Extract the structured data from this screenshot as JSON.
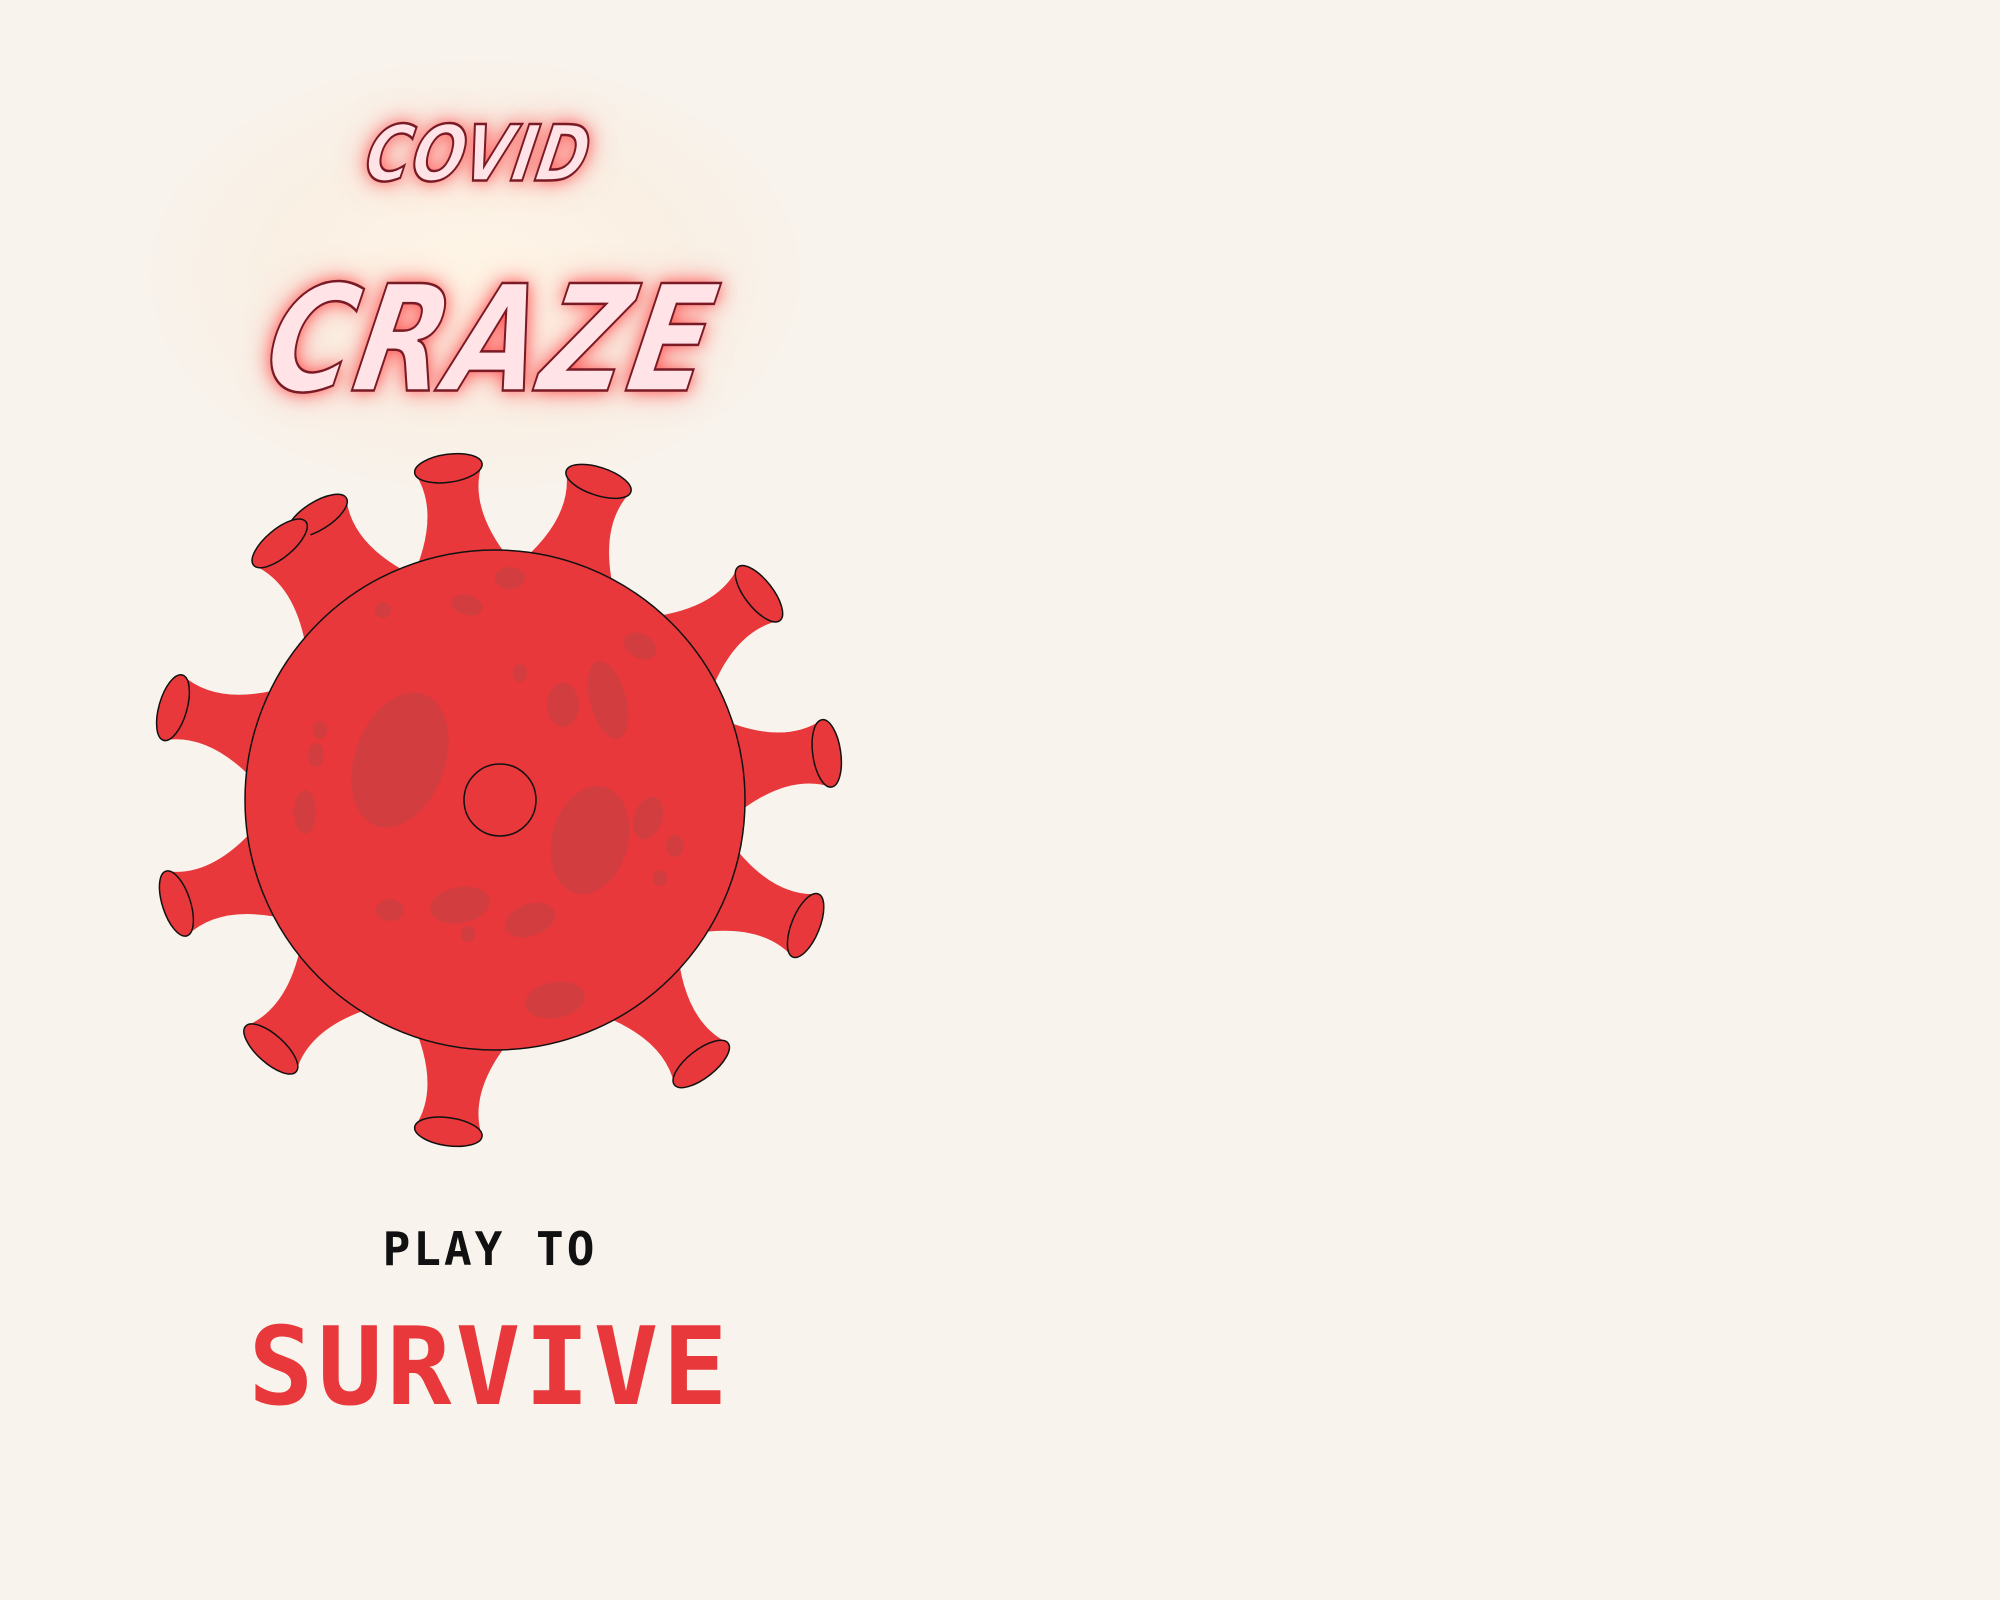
{
  "title": {
    "line1": "COVID",
    "line2": "CRAZE"
  },
  "hero": {
    "icon": "virus-icon"
  },
  "tagline": {
    "line1": "PLAY TO",
    "line2": "SURVIVE"
  },
  "colors": {
    "background": "#f8f3ec",
    "virus": "#e8383b",
    "virus_spot": "#d23d40",
    "title_fill": "#ffe3e6",
    "title_glow": "#ff4646",
    "tagline_accent": "#e8383b",
    "tagline_text": "#111111"
  }
}
